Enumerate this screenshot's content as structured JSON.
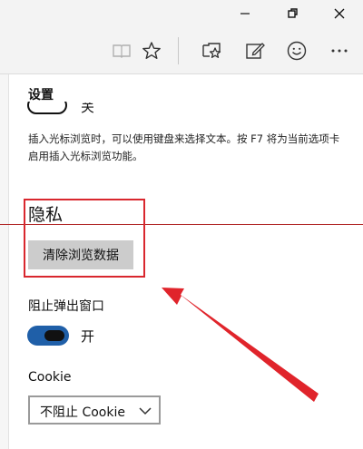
{
  "icons": {
    "minimize": "minimize-icon",
    "maximize": "restore-icon",
    "close": "close-icon",
    "reading_view": "reading-view-icon",
    "favorite": "star-icon",
    "hub": "hub-icon",
    "notes": "web-note-icon",
    "feedback": "smiley-icon",
    "more": "more-icon",
    "dropdown": "chevron-down-icon"
  },
  "settings": {
    "title": "设置",
    "caret_toggle_label": "关",
    "caret_description": "插入光标浏览时，可以使用键盘来选择文本。按 F7 将为当前选项卡启用插入光标浏览功能。",
    "privacy_heading": "隐私",
    "clear_button_label": "清除浏览数据",
    "block_popups_label": "阻止弹出窗口",
    "block_popups_state": "开",
    "cookie_label": "Cookie",
    "cookie_value": "不阻止 Cookie"
  },
  "colors": {
    "annotation_red": "#d9272e",
    "toggle_on": "#1f5fa8",
    "button_gray": "#cccccc"
  }
}
